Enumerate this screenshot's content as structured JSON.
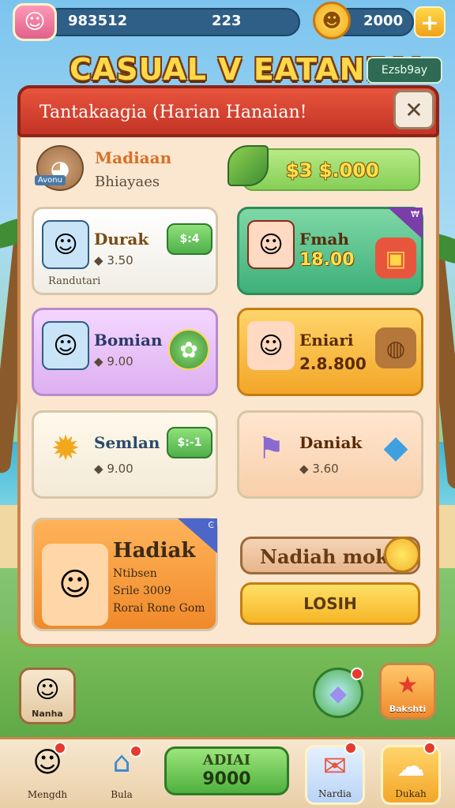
{
  "topbar": {
    "gems": "983512",
    "level": "223",
    "coins": "2000",
    "plus_label": "+",
    "avatar_icon": "cookie-icon",
    "coin_icon": "banana-coin-icon"
  },
  "title": {
    "text": "CASUAL V EATANEAI",
    "badge": "Ezsb9ay"
  },
  "panel": {
    "header": "Tantakaagia (Harian Hanaian!",
    "close_label": "✕",
    "pet": {
      "name": "Madiaan",
      "subtitle": "Bhiayaes",
      "tag": "Avonu"
    },
    "currency_pill": "$3 $.000",
    "cards": [
      {
        "name": "Durak",
        "price": "3.50",
        "caption": "Randutari",
        "bubble": "$:4",
        "style": "white"
      },
      {
        "name": "Fmah",
        "price": "18.00",
        "ribbon": "₩",
        "style": "green"
      },
      {
        "name": "Bomian",
        "price": "9.00",
        "style": "purple"
      },
      {
        "name": "Eniari",
        "price": "2.8.800",
        "style": "orange"
      },
      {
        "name": "Semlan",
        "price": "9.00",
        "bubble": "$:-1",
        "style": "white"
      },
      {
        "name": "Daniak",
        "price": "3.60",
        "style": "peach"
      }
    ],
    "big_card": {
      "name": "Hadiak",
      "line1": "Ntibsen",
      "line2": "Srile 3009",
      "line3": "Rorai Rone Gom",
      "ribbon": "Ͼ"
    },
    "claim_label": "Nadiah mok",
    "claim_button": "LOSIH"
  },
  "side": {
    "left_label": "Nanha",
    "right_label": "Bakshti"
  },
  "bottom_nav": {
    "items": [
      {
        "label": "Mengdh",
        "icon": "character-icon"
      },
      {
        "label": "Bula",
        "icon": "house-icon"
      },
      {
        "label": "Nardia",
        "icon": "letter-icon"
      },
      {
        "label": "Dukah",
        "icon": "cloud-icon"
      }
    ],
    "center_top": "ADIAI",
    "center_value": "9000"
  },
  "colors": {
    "header_red": "#c33426",
    "panel_bg": "#fbe7cf",
    "gold": "#ffd84a",
    "green_btn": "#4fb03e"
  }
}
